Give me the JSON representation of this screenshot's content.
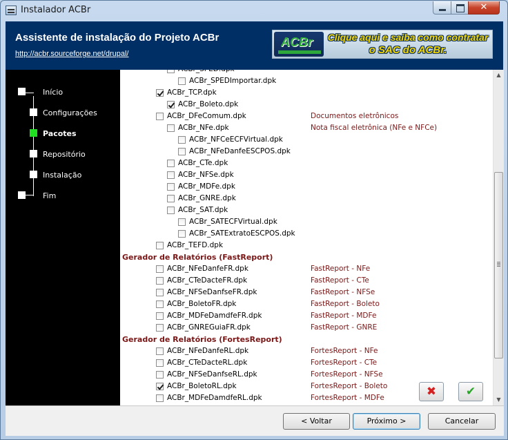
{
  "window": {
    "title": "Instalador ACBr"
  },
  "header": {
    "title": "Assistente de instalação do Projeto ACBr",
    "link": "http://acbr.sourceforge.net/drupal/",
    "banner_logo": "ACBr",
    "banner_line1": "Clique aqui e saiba como contratar",
    "banner_line2": "o SAC do ACBr."
  },
  "steps": [
    {
      "label": "Início",
      "active": false
    },
    {
      "label": "Configurações",
      "active": false
    },
    {
      "label": "Pacotes",
      "active": true
    },
    {
      "label": "Repositório",
      "active": false
    },
    {
      "label": "Instalação",
      "active": false
    },
    {
      "label": "Fim",
      "active": false
    }
  ],
  "packages": {
    "rows": [
      {
        "name": "ACBr_SPED.dpk",
        "level": 1,
        "checked": false,
        "desc": ""
      },
      {
        "name": "ACBr_SPEDImportar.dpk",
        "level": 2,
        "checked": false,
        "desc": ""
      },
      {
        "name": "ACBr_TCP.dpk",
        "level": 0,
        "checked": true,
        "desc": ""
      },
      {
        "name": "ACBr_Boleto.dpk",
        "level": 1,
        "checked": true,
        "desc": ""
      },
      {
        "name": "ACBr_DFeComum.dpk",
        "level": 0,
        "checked": false,
        "desc": "Documentos eletrônicos"
      },
      {
        "name": "ACBr_NFe.dpk",
        "level": 1,
        "checked": false,
        "desc": "Nota fiscal eletrônica (NFe e NFCe)"
      },
      {
        "name": "ACBr_NFCeECFVirtual.dpk",
        "level": 2,
        "checked": false,
        "desc": ""
      },
      {
        "name": "ACBr_NFeDanfeESCPOS.dpk",
        "level": 2,
        "checked": false,
        "desc": ""
      },
      {
        "name": "ACBr_CTe.dpk",
        "level": 1,
        "checked": false,
        "desc": ""
      },
      {
        "name": "ACBr_NFSe.dpk",
        "level": 1,
        "checked": false,
        "desc": ""
      },
      {
        "name": "ACBr_MDFe.dpk",
        "level": 1,
        "checked": false,
        "desc": ""
      },
      {
        "name": "ACBr_GNRE.dpk",
        "level": 1,
        "checked": false,
        "desc": ""
      },
      {
        "name": "ACBr_SAT.dpk",
        "level": 1,
        "checked": false,
        "desc": ""
      },
      {
        "name": "ACBr_SATECFVirtual.dpk",
        "level": 2,
        "checked": false,
        "desc": ""
      },
      {
        "name": "ACBr_SATExtratoESCPOS.dpk",
        "level": 2,
        "checked": false,
        "desc": ""
      },
      {
        "name": "ACBr_TEFD.dpk",
        "level": 0,
        "checked": false,
        "desc": ""
      }
    ],
    "group_fastreport": "Gerador de Relatórios (FastReport)",
    "fastreport_rows": [
      {
        "name": "ACBr_NFeDanfeFR.dpk",
        "checked": false,
        "desc": "FastReport - NFe"
      },
      {
        "name": "ACBr_CTeDacteFR.dpk",
        "checked": false,
        "desc": "FastReport - CTe"
      },
      {
        "name": "ACBr_NFSeDanfseFR.dpk",
        "checked": false,
        "desc": "FastReport - NFSe"
      },
      {
        "name": "ACBr_BoletoFR.dpk",
        "checked": false,
        "desc": "FastReport - Boleto"
      },
      {
        "name": "ACBr_MDFeDamdfeFR.dpk",
        "checked": false,
        "desc": "FastReport - MDFe"
      },
      {
        "name": "ACBr_GNREGuiaFR.dpk",
        "checked": false,
        "desc": "FastReport - GNRE"
      }
    ],
    "group_fortesreport": "Gerador de Relatórios (FortesReport)",
    "fortesreport_rows": [
      {
        "name": "ACBr_NFeDanfeRL.dpk",
        "checked": false,
        "desc": "FortesReport - NFe"
      },
      {
        "name": "ACBr_CTeDacteRL.dpk",
        "checked": false,
        "desc": "FortesReport - CTe"
      },
      {
        "name": "ACBr_NFSeDanfseRL.dpk",
        "checked": false,
        "desc": "FortesReport - NFSe"
      },
      {
        "name": "ACBr_BoletoRL.dpk",
        "checked": true,
        "desc": "FortesReport - Boleto"
      },
      {
        "name": "ACBr_MDFeDamdfeRL.dpk",
        "checked": false,
        "desc": "FortesReport - MDFe"
      }
    ]
  },
  "footer": {
    "back_label": "< Voltar",
    "next_label": "Próximo >",
    "cancel_label": "Cancelar"
  },
  "colors": {
    "header_bg": "#002f66",
    "active_step": "#21e021",
    "group_title": "#7a1616"
  }
}
